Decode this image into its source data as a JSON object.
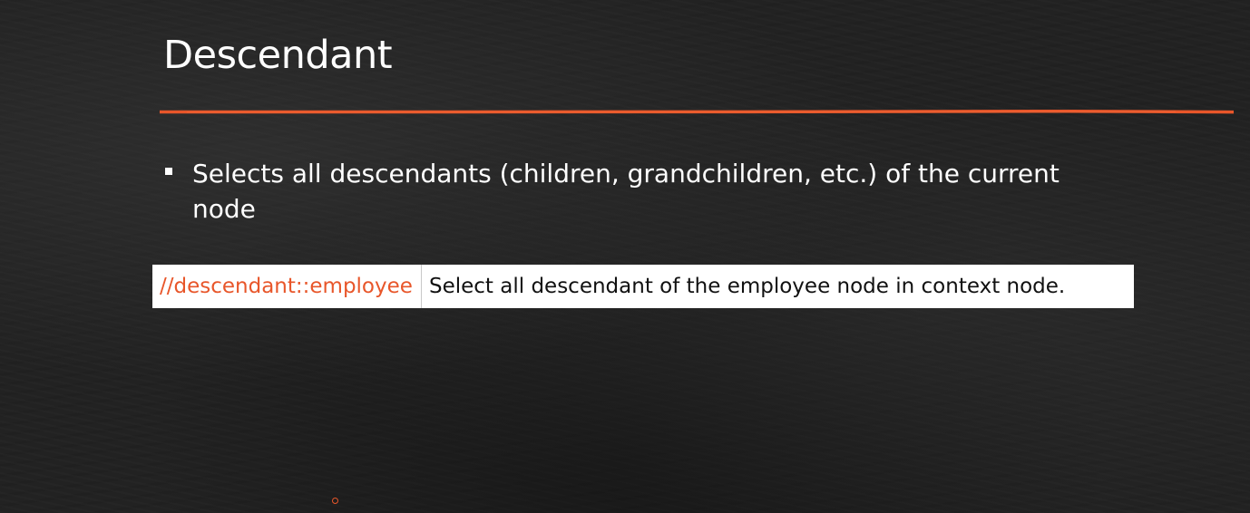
{
  "slide": {
    "title": "Descendant",
    "bullets": [
      "Selects all descendants (children, grandchildren, etc.) of the current node"
    ],
    "table": {
      "rows": [
        {
          "expression": "//descendant::employee",
          "description": "Select all descendant of the employee node in context node."
        }
      ]
    }
  },
  "colors": {
    "background": "#222222",
    "accent": "#e8562a",
    "text": "#ffffff",
    "table_bg": "#ffffff",
    "table_text": "#111111"
  },
  "icons": {
    "bullet": "square-bullet-icon",
    "pointer": "laser-pointer-icon"
  }
}
